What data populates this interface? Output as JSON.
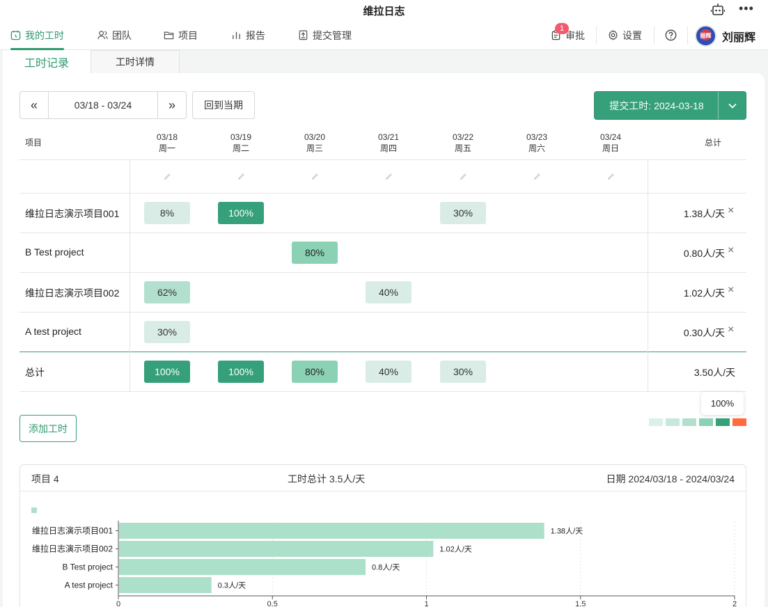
{
  "app": {
    "title": "维拉日志"
  },
  "nav": {
    "items": [
      {
        "label": "我的工时",
        "icon": "clock-icon"
      },
      {
        "label": "团队",
        "icon": "users-icon"
      },
      {
        "label": "项目",
        "icon": "folder-icon"
      },
      {
        "label": "报告",
        "icon": "bar-chart-icon"
      },
      {
        "label": "提交管理",
        "icon": "upload-doc-icon"
      }
    ],
    "approval": {
      "label": "审批",
      "badge": "1"
    },
    "settings": {
      "label": "设置"
    },
    "user": {
      "name": "刘丽辉",
      "avatar_text": "丽辉"
    }
  },
  "tabs": [
    {
      "label": "工时记录"
    },
    {
      "label": "工时详情"
    }
  ],
  "toolbar": {
    "prev": "«",
    "range": "03/18 - 03/24",
    "next": "»",
    "today_label": "回到当期",
    "submit_label": "提交工时: 2024-03-18"
  },
  "table": {
    "project_header": "项目",
    "total_header": "总计",
    "days": [
      {
        "date": "03/18",
        "weekday": "周一"
      },
      {
        "date": "03/19",
        "weekday": "周二"
      },
      {
        "date": "03/20",
        "weekday": "周三"
      },
      {
        "date": "03/21",
        "weekday": "周四"
      },
      {
        "date": "03/22",
        "weekday": "周五"
      },
      {
        "date": "03/23",
        "weekday": "周六"
      },
      {
        "date": "03/24",
        "weekday": "周日"
      }
    ],
    "rows": [
      {
        "name": "维拉日志演示项目001",
        "cells": [
          "8%",
          "100%",
          "",
          "",
          "30%",
          "",
          ""
        ],
        "total": "1.38人/天"
      },
      {
        "name": "B Test project",
        "cells": [
          "",
          "",
          "80%",
          "",
          "",
          "",
          ""
        ],
        "total": "0.80人/天"
      },
      {
        "name": "维拉日志演示项目002",
        "cells": [
          "62%",
          "",
          "",
          "40%",
          "",
          "",
          ""
        ],
        "total": "1.02人/天"
      },
      {
        "name": "A test project",
        "cells": [
          "30%",
          "",
          "",
          "",
          "",
          "",
          ""
        ],
        "total": "0.30人/天"
      }
    ],
    "summary_row": {
      "name": "总计",
      "cells": [
        "100%",
        "100%",
        "80%",
        "40%",
        "30%",
        "",
        ""
      ],
      "total": "3.50人/天"
    },
    "remove_symbol": "×"
  },
  "tooltip": "100%",
  "legend_colors": [
    "#dcefe8",
    "#c9e8dc",
    "#b3dfcf",
    "#8bd1b4",
    "#35a07a",
    "#ff6b3d"
  ],
  "add_button": "添加工时",
  "summary": {
    "projects": "项目 4",
    "total": "工时总计 3.5人/天",
    "period": "日期 2024/03/18 - 2024/03/24"
  },
  "chart_data": {
    "type": "bar",
    "orientation": "horizontal",
    "categories": [
      "维拉日志演示项目001",
      "维拉日志演示项目002",
      "B Test project",
      "A test project"
    ],
    "values": [
      1.38,
      1.02,
      0.8,
      0.3
    ],
    "data_labels": [
      "1.38人/天",
      "1.02人/天",
      "0.8人/天",
      "0.3人/天"
    ],
    "x_ticks": [
      "0",
      "0.5",
      "1",
      "1.5",
      "2"
    ],
    "xlim": [
      0,
      2
    ],
    "bar_color": "#ade0cb",
    "grid": true
  }
}
